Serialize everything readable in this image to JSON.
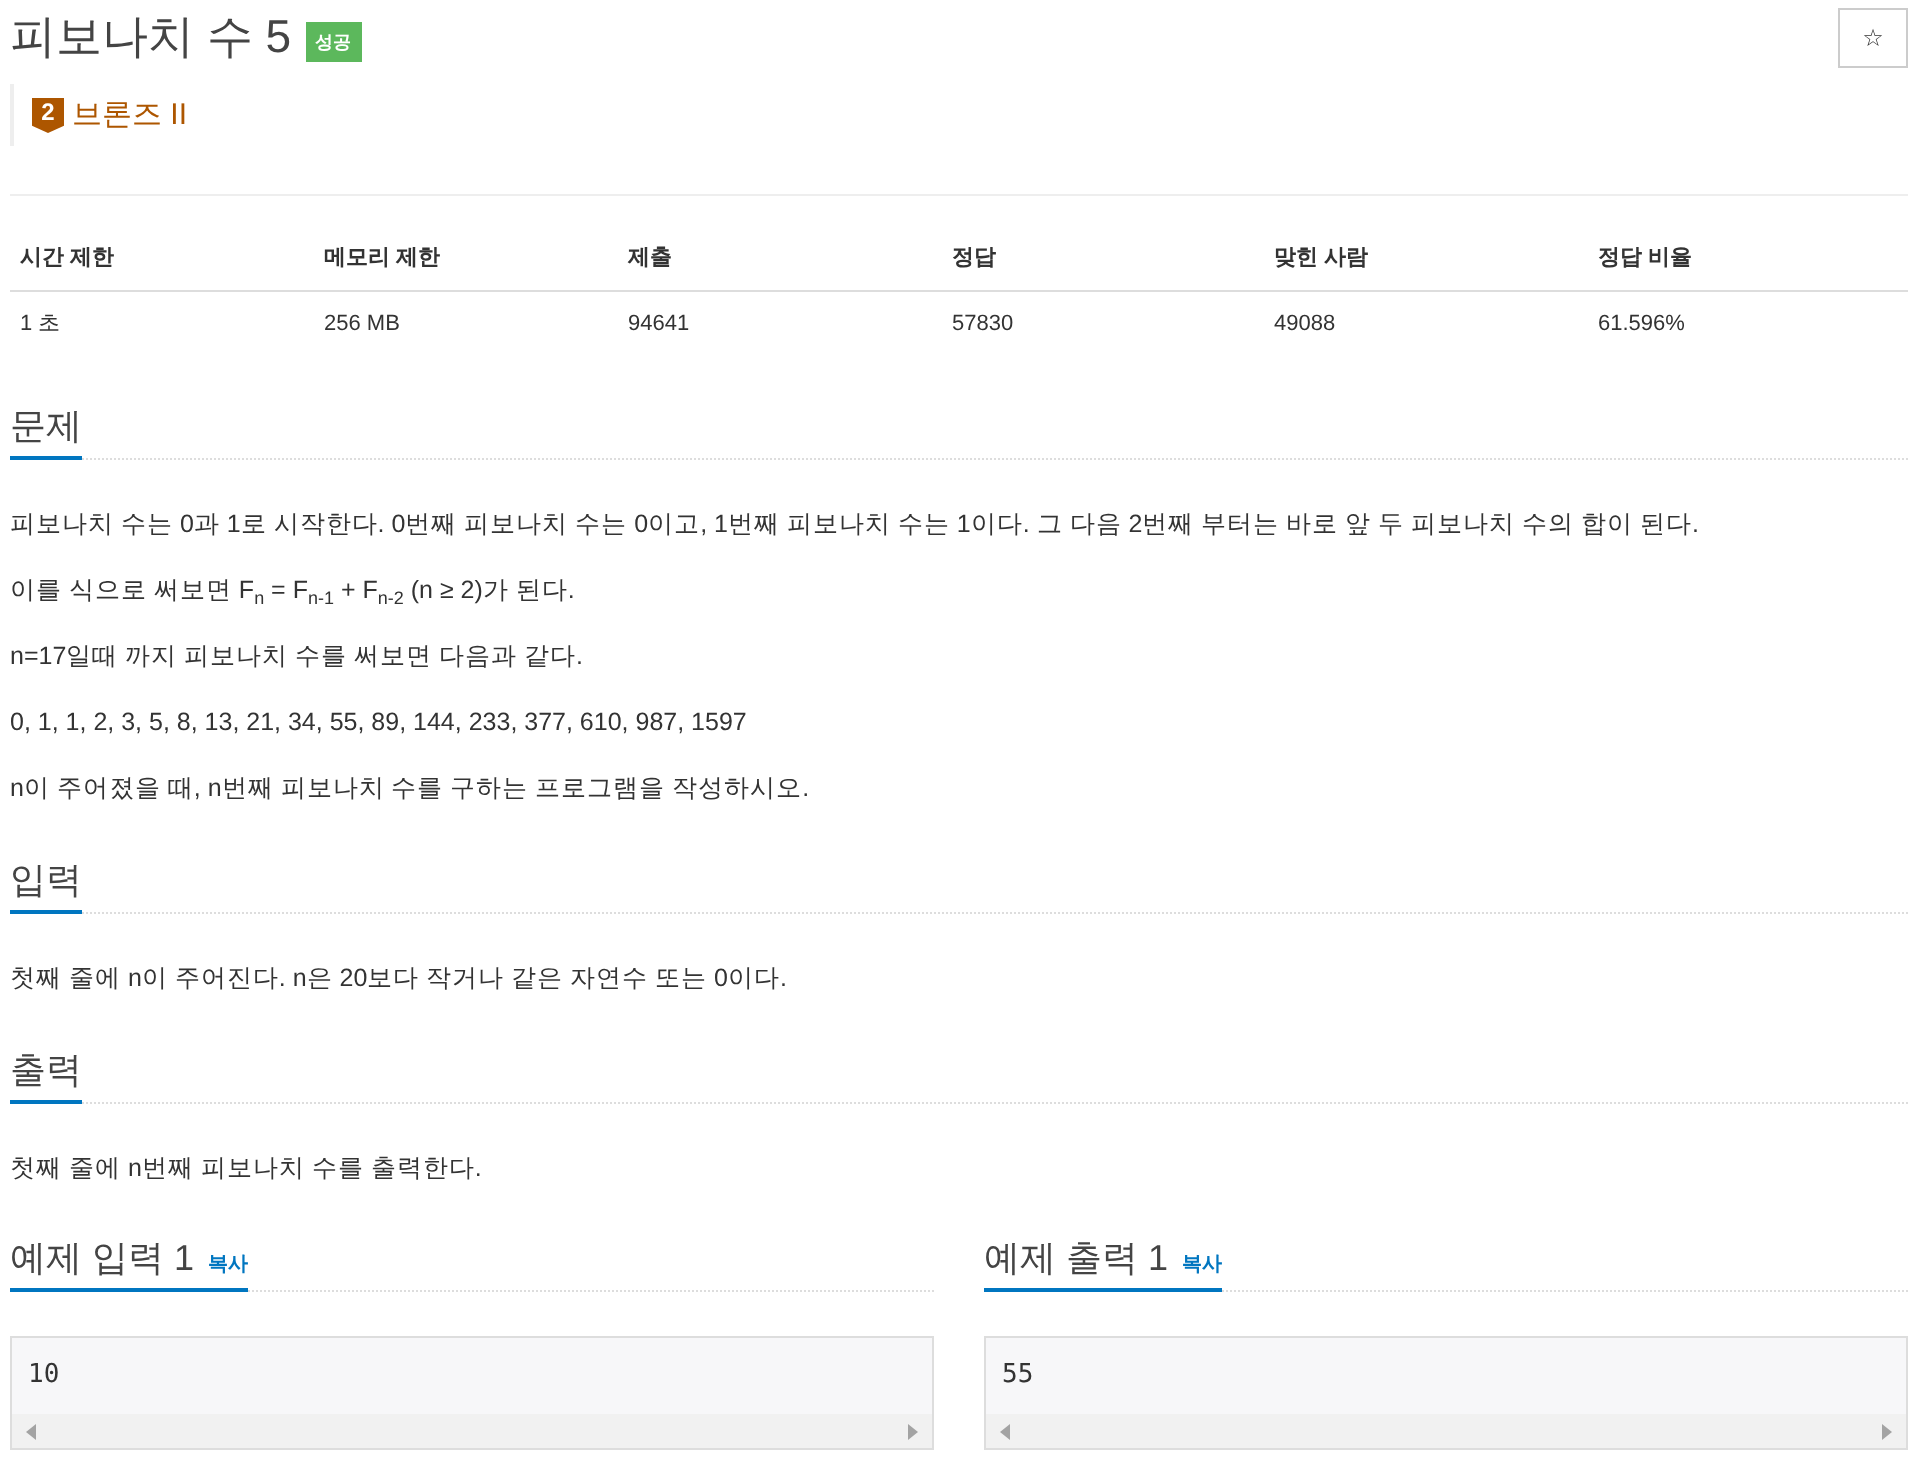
{
  "problem": {
    "title": "피보나치 수 5",
    "result_badge": "성공",
    "star_button": "☆",
    "tier": {
      "number": "2",
      "label": "브론즈 II"
    }
  },
  "stats_table": {
    "columns": [
      "시간 제한",
      "메모리 제한",
      "제출",
      "정답",
      "맞힌 사람",
      "정답 비율"
    ],
    "rows": [
      [
        "1 초",
        "256 MB",
        "94641",
        "57830",
        "49088",
        "61.596%"
      ]
    ]
  },
  "sections": [
    {
      "heading": "문제",
      "paragraphs": [
        "피보나치 수는 0과 1로 시작한다. 0번째 피보나치 수는 0이고, 1번째 피보나치 수는 1이다. 그 다음 2번째 부터는 바로 앞 두 피보나치 수의 합이 된다.",
        "이를 식으로 써보면 F$_{n}$ = F$_{n-1}$ + F$_{n-2}$ (n ≥ 2)가 된다.",
        "n=17일때 까지 피보나치 수를 써보면 다음과 같다.",
        "0, 1, 1, 2, 3, 5, 8, 13, 21, 34, 55, 89, 144, 233, 377, 610, 987, 1597",
        "n이 주어졌을 때, n번째 피보나치 수를 구하는 프로그램을 작성하시오."
      ]
    },
    {
      "heading": "입력",
      "paragraphs": [
        "첫째 줄에 n이 주어진다. n은 20보다 작거나 같은 자연수 또는 0이다."
      ]
    },
    {
      "heading": "출력",
      "paragraphs": [
        "첫째 줄에 n번째 피보나치 수를 출력한다."
      ]
    }
  ],
  "samples": [
    {
      "heading": "예제 입력 1",
      "copy_link": "복사",
      "content": "10"
    },
    {
      "heading": "예제 출력 1",
      "copy_link": "복사",
      "content": "55"
    }
  ]
}
